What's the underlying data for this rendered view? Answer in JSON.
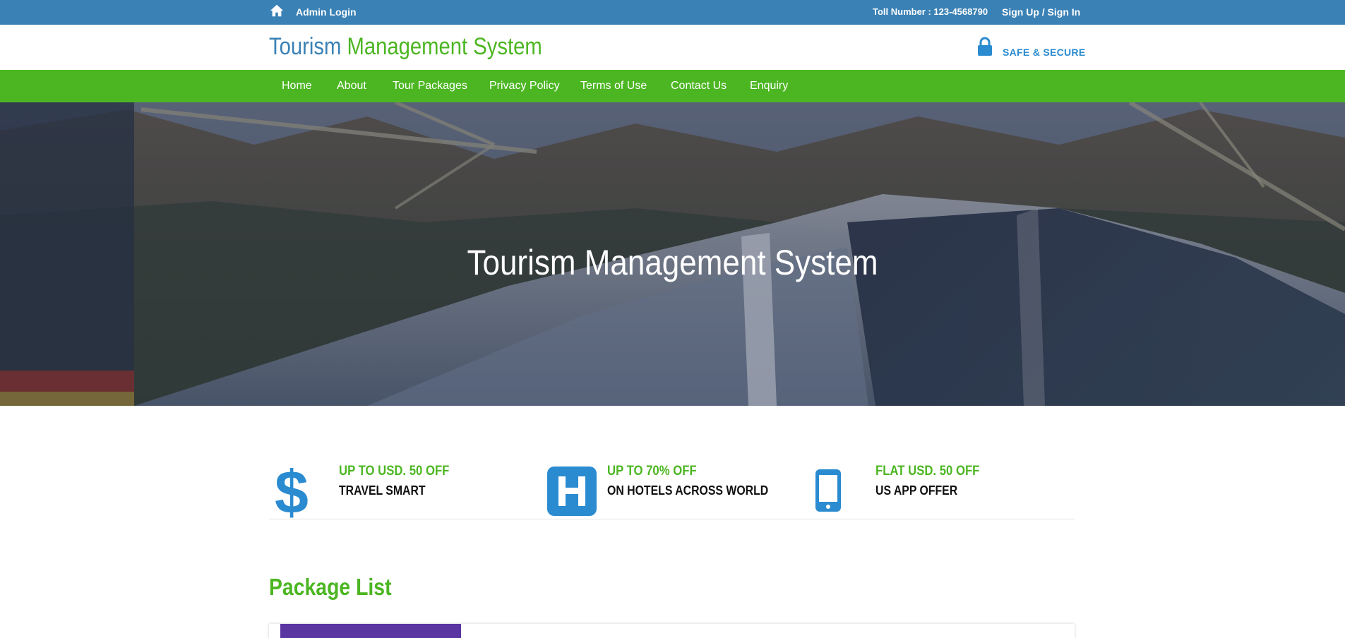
{
  "topbar": {
    "admin_label": "Admin Login",
    "toll_label": "Toll Number : 123-4568790",
    "signup_label": "Sign Up / Sign In"
  },
  "brand": {
    "part1": "Tourism",
    "part2": "Management System",
    "secure_label": "SAFE & SECURE"
  },
  "nav": {
    "items": [
      {
        "label": "Home"
      },
      {
        "label": "About"
      },
      {
        "label": "Tour Packages"
      },
      {
        "label": "Privacy Policy"
      },
      {
        "label": "Terms of Use"
      },
      {
        "label": "Contact Us"
      },
      {
        "label": "Enquiry"
      }
    ]
  },
  "hero": {
    "title": "Tourism Management System"
  },
  "offers": [
    {
      "icon": "dollar-icon",
      "title": "UP TO USD. 50 OFF",
      "subtitle": "TRAVEL SMART"
    },
    {
      "icon": "hotel-icon",
      "title": "UP TO 70% OFF",
      "subtitle": "ON HOTELS ACROSS WORLD"
    },
    {
      "icon": "mobile-icon",
      "title": "FLAT USD. 50 OFF",
      "subtitle": "US APP OFFER"
    }
  ],
  "packages": {
    "heading": "Package List"
  },
  "colors": {
    "topbar": "#3a81b5",
    "nav": "#4cb622",
    "accent_blue": "#2a8bd0",
    "accent_green": "#4cb622"
  }
}
